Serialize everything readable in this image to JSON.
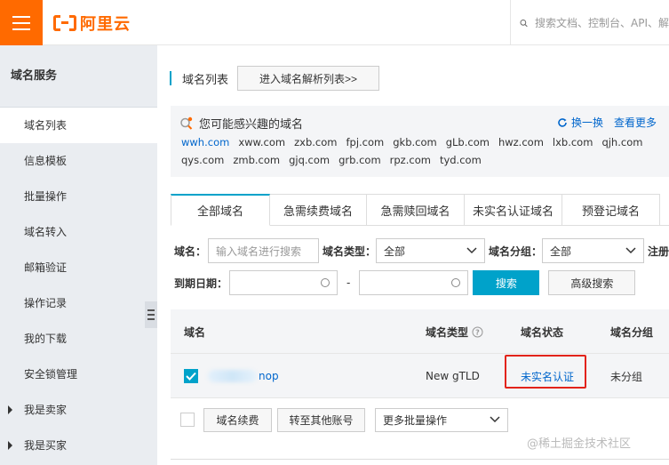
{
  "header": {
    "brand": "阿里云",
    "search_placeholder": "搜索文档、控制台、API、解"
  },
  "sidebar": {
    "title": "域名服务",
    "items": [
      {
        "label": "域名列表",
        "active": true
      },
      {
        "label": "信息模板"
      },
      {
        "label": "批量操作"
      },
      {
        "label": "域名转入"
      },
      {
        "label": "邮箱验证"
      },
      {
        "label": "操作记录"
      },
      {
        "label": "我的下载"
      },
      {
        "label": "安全锁管理"
      },
      {
        "label": "我是卖家",
        "expandable": true
      },
      {
        "label": "我是买家",
        "expandable": true
      }
    ]
  },
  "page": {
    "title": "域名列表",
    "goto_dns_button": "进入域名解析列表>>"
  },
  "suggest": {
    "heading": "您可能感兴趣的域名",
    "refresh": "换一换",
    "more": "查看更多",
    "domains": [
      "wwh.com",
      "xww.com",
      "zxb.com",
      "fpj.com",
      "gkb.com",
      "gLb.com",
      "hwz.com",
      "lxb.com",
      "qjh.com",
      "qys.com",
      "zmb.com",
      "gjq.com",
      "grb.com",
      "rpz.com",
      "tyd.com"
    ]
  },
  "tabs": [
    "全部域名",
    "急需续费域名",
    "急需赎回域名",
    "未实名认证域名",
    "预登记域名"
  ],
  "filters": {
    "domain_label": "域名：",
    "domain_placeholder": "输入域名进行搜索",
    "type_label": "域名类型：",
    "type_value": "全部",
    "group_label": "域名分组：",
    "group_value": "全部",
    "reg_label": "注册",
    "expire_label": "到期日期：",
    "date_sep": "-",
    "search_button": "搜索",
    "advanced_button": "高级搜索"
  },
  "table": {
    "headers": {
      "domain": "域名",
      "type": "域名类型",
      "status": "域名状态",
      "group": "域名分组"
    },
    "rows": [
      {
        "domain_suffix": "nop",
        "type": "New gTLD",
        "status": "未实名认证",
        "group": "未分组",
        "checked": true
      }
    ]
  },
  "batch": {
    "renew": "域名续费",
    "transfer": "转至其他账号",
    "more_ops": "更多批量操作"
  },
  "watermark": "@稀土掘金技术社区"
}
